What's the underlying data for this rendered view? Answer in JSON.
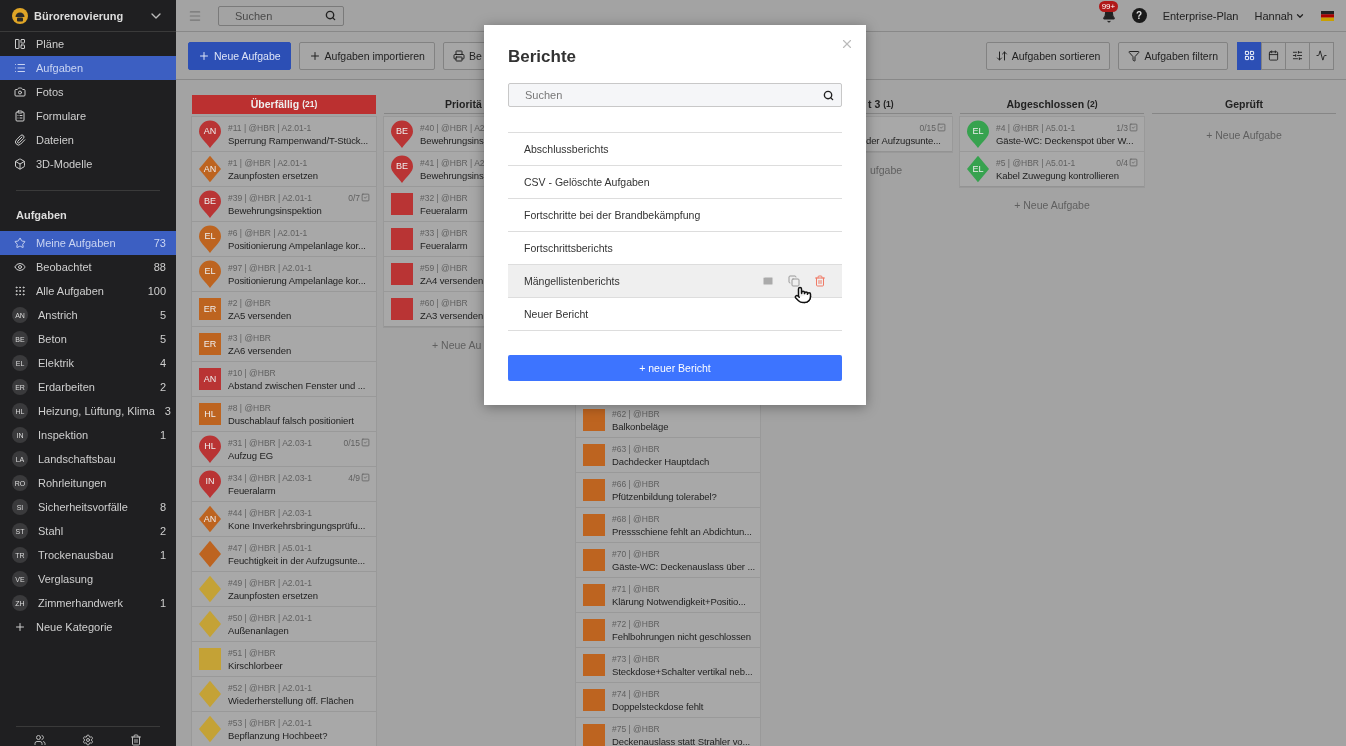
{
  "sidebar": {
    "project": "Bürorenovierung",
    "nav": [
      {
        "label": "Pläne",
        "selected": false
      },
      {
        "label": "Aufgaben",
        "selected": true
      },
      {
        "label": "Fotos",
        "selected": false
      },
      {
        "label": "Formulare",
        "selected": false
      },
      {
        "label": "Dateien",
        "selected": false
      },
      {
        "label": "3D-Modelle",
        "selected": false
      }
    ],
    "section_title": "Aufgaben",
    "items": [
      {
        "kind": "filter",
        "label": "Meine Aufgaben",
        "count": "73",
        "selected": true
      },
      {
        "kind": "filter",
        "label": "Beobachtet",
        "count": "88",
        "selected": false
      },
      {
        "kind": "filter",
        "label": "Alle Aufgaben",
        "count": "100",
        "selected": false
      },
      {
        "kind": "category",
        "initials": "AN",
        "label": "Anstrich",
        "count": "5",
        "selected": false
      },
      {
        "kind": "category",
        "initials": "BE",
        "label": "Beton",
        "count": "5",
        "selected": false
      },
      {
        "kind": "category",
        "initials": "EL",
        "label": "Elektrik",
        "count": "4",
        "selected": false
      },
      {
        "kind": "category",
        "initials": "ER",
        "label": "Erdarbeiten",
        "count": "2",
        "selected": false
      },
      {
        "kind": "category",
        "initials": "HL",
        "label": "Heizung, Lüftung, Klima",
        "count": "3",
        "selected": false
      },
      {
        "kind": "category",
        "initials": "IN",
        "label": "Inspektion",
        "count": "1",
        "selected": false
      },
      {
        "kind": "category",
        "initials": "LA",
        "label": "Landschaftsbau",
        "selected": false
      },
      {
        "kind": "category",
        "initials": "RO",
        "label": "Rohrleitungen",
        "selected": false
      },
      {
        "kind": "category",
        "initials": "SI",
        "label": "Sicherheitsvorfälle",
        "count": "8",
        "selected": false
      },
      {
        "kind": "category",
        "initials": "ST",
        "label": "Stahl",
        "count": "2",
        "selected": false
      },
      {
        "kind": "category",
        "initials": "TR",
        "label": "Trockenausbau",
        "count": "1",
        "selected": false
      },
      {
        "kind": "category",
        "initials": "VE",
        "label": "Verglasung",
        "selected": false
      },
      {
        "kind": "category",
        "initials": "ZH",
        "label": "Zimmerhandwerk",
        "count": "1",
        "selected": false
      }
    ],
    "add_category": "Neue Kategorie"
  },
  "topbar": {
    "search": {
      "placeholder": "Suchen"
    },
    "notifications": "99+",
    "help": "?",
    "plan": "Enterprise-Plan",
    "user": "Hannah"
  },
  "toolbar": {
    "left": [
      {
        "kind": "primary",
        "label": "Neue Aufgabe"
      },
      {
        "kind": "default",
        "label": "Aufgaben importieren"
      },
      {
        "kind": "default",
        "label": "Be"
      }
    ],
    "right": [
      {
        "label": "Aufgaben sortieren"
      },
      {
        "label": "Aufgaben filtern"
      }
    ],
    "views": [
      {
        "kind": "grid",
        "selected": true
      },
      {
        "kind": "calendar",
        "selected": false
      },
      {
        "kind": "gantt",
        "selected": false
      },
      {
        "kind": "chart",
        "selected": false
      }
    ]
  },
  "board": {
    "columns": [
      {
        "kind": "overdue",
        "title": "Überfällig",
        "count": "(21)",
        "cards": [
          {
            "kind": "pin",
            "color": "#b93434",
            "initials": "AN",
            "meta": "#11 | @HBR | A2.01-1",
            "title": "Sperrung Rampenwand/T-Stück..."
          },
          {
            "kind": "diamond",
            "color": "#bd6420",
            "initials": "AN",
            "meta": "#1 | @HBR | A2.01-1",
            "title": "Zaunpfosten ersetzen"
          },
          {
            "kind": "pin",
            "color": "#b93434",
            "initials": "BE",
            "meta": "#39 | @HBR | A2.01-1",
            "checklist": "0/7",
            "title": "Bewehrungsinspektion"
          },
          {
            "kind": "pin",
            "color": "#bd6420",
            "initials": "EL",
            "meta": "#6 | @HBR | A2.01-1",
            "title": "Positionierung Ampelanlage kor..."
          },
          {
            "kind": "pin",
            "color": "#bd6420",
            "initials": "EL",
            "meta": "#97 | @HBR | A2.01-1",
            "title": "Positionierung Ampelanlage kor..."
          },
          {
            "kind": "square",
            "color": "#bd6420",
            "initials": "ER",
            "meta": "#2 | @HBR",
            "title": "ZA5 versenden"
          },
          {
            "kind": "square",
            "color": "#bd6420",
            "initials": "ER",
            "meta": "#3 | @HBR",
            "title": "ZA6 versenden"
          },
          {
            "kind": "square",
            "color": "#b93434",
            "initials": "AN",
            "meta": "#10 | @HBR",
            "title": "Abstand zwischen Fenster und ..."
          },
          {
            "kind": "square",
            "color": "#bd6420",
            "initials": "HL",
            "meta": "#8 | @HBR",
            "title": "Duschablauf falsch positioniert"
          },
          {
            "kind": "pin",
            "color": "#b93434",
            "initials": "HL",
            "meta": "#31 | @HBR | A2.03-1",
            "checklist": "0/15",
            "title": "Aufzug EG"
          },
          {
            "kind": "pin",
            "color": "#b93434",
            "initials": "IN",
            "meta": "#34 | @HBR | A2.03-1",
            "checklist": "4/9",
            "title": "Feueralarm"
          },
          {
            "kind": "diamond",
            "color": "#bd6420",
            "initials": "AN",
            "meta": "#44 | @HBR | A2.03-1",
            "title": "Kone Inverkehrsbringungsprüfu..."
          },
          {
            "kind": "diamond",
            "color": "#bd6420",
            "meta": "#47 | @HBR | A5.01-1",
            "title": "Feuchtigkeit in der Aufzugsunte..."
          },
          {
            "kind": "diamond",
            "color": "#c4a236",
            "meta": "#49 | @HBR | A2.01-1",
            "title": "Zaunpfosten ersetzen"
          },
          {
            "kind": "diamond",
            "color": "#c4a236",
            "meta": "#50 | @HBR | A2.01-1",
            "title": "Außenanlagen"
          },
          {
            "kind": "square",
            "color": "#c4a236",
            "meta": "#51 | @HBR",
            "title": "Kirschlorbeer"
          },
          {
            "kind": "diamond",
            "color": "#c4a236",
            "meta": "#52 | @HBR | A2.01-1",
            "title": "Wiederherstellung öff. Flächen"
          },
          {
            "kind": "diamond",
            "color": "#c4a236",
            "meta": "#53 | @HBR | A2.01-1",
            "title": "Bepflanzung Hochbeet?"
          }
        ]
      },
      {
        "kind": "normal",
        "title": "Prioritä",
        "cards": [
          {
            "kind": "pin",
            "color": "#b93434",
            "initials": "BE",
            "meta": "#40 | @HBR | A2.",
            "title": "Bewehrungsins"
          },
          {
            "kind": "pin",
            "color": "#b93434",
            "initials": "BE",
            "meta": "#41 | @HBR | A2.",
            "title": "Bewehrungsins"
          },
          {
            "kind": "square",
            "color": "#b93434",
            "meta": "#32 | @HBR",
            "title": "Feueralarm"
          },
          {
            "kind": "square",
            "color": "#b93434",
            "meta": "#33 | @HBR",
            "title": "Feueralarm"
          },
          {
            "kind": "square",
            "color": "#b93434",
            "meta": "#59 | @HBR",
            "title": "ZA4 versenden"
          },
          {
            "kind": "square",
            "color": "#b93434",
            "meta": "#60 | @HBR",
            "title": "ZA3 versenden"
          }
        ],
        "add": "+ Neue Au"
      },
      {
        "cards": [
          {
            "kind": "square",
            "color": "#bd6420",
            "meta": "#62 | @HBR",
            "title": "Balkonbeläge"
          },
          {
            "kind": "square",
            "color": "#bd6420",
            "meta": "#63 | @HBR",
            "title": "Dachdecker Hauptdach"
          },
          {
            "kind": "square",
            "color": "#bd6420",
            "meta": "#66 | @HBR",
            "title": "Pfützenbildung tolerabel?"
          },
          {
            "kind": "square",
            "color": "#bd6420",
            "meta": "#68 | @HBR",
            "title": "Pressschiene fehlt an Abdichtun..."
          },
          {
            "kind": "square",
            "color": "#bd6420",
            "meta": "#70 | @HBR",
            "title": "Gäste-WC: Deckenauslass über ..."
          },
          {
            "kind": "square",
            "color": "#bd6420",
            "meta": "#71 | @HBR",
            "title": "Klärung Notwendigkeit+Positio..."
          },
          {
            "kind": "square",
            "color": "#bd6420",
            "meta": "#72 | @HBR",
            "title": "Fehlbohrungen nicht geschlossen"
          },
          {
            "kind": "square",
            "color": "#bd6420",
            "meta": "#73 | @HBR",
            "title": "Steckdose+Schalter vertikal neb..."
          },
          {
            "kind": "square",
            "color": "#bd6420",
            "meta": "#74 | @HBR",
            "title": "Doppelsteckdose fehlt"
          },
          {
            "kind": "square",
            "color": "#bd6420",
            "meta": "#75 | @HBR",
            "title": "Deckenauslass statt Strahler vo..."
          }
        ]
      },
      {
        "kind": "normal",
        "title": "t 3",
        "count": "(1)",
        "cards": [
          {
            "checklist": "0/15",
            "title": "der Aufzugsunte..."
          }
        ],
        "add": "ufgabe"
      },
      {
        "kind": "normal",
        "title": "Abgeschlossen",
        "count": "(2)",
        "cards": [
          {
            "kind": "pin",
            "color": "#37a24f",
            "initials": "EL",
            "meta": "#4 | @HBR | A5.01-1",
            "checklist": "1/3",
            "title": "Gäste-WC: Deckenspot über W..."
          },
          {
            "kind": "diamond",
            "color": "#37a24f",
            "initials": "EL",
            "meta": "#5 | @HBR | A5.01-1",
            "checklist": "0/4",
            "title": "Kabel Zuwegung kontrollieren"
          }
        ],
        "add": "+ Neue Aufgabe"
      },
      {
        "kind": "normal",
        "title": "Geprüft",
        "add": "+ Neue Aufgabe"
      }
    ]
  },
  "dialog": {
    "title": "Berichte",
    "search": {
      "placeholder": "Suchen"
    },
    "reports": [
      {
        "label": "Abschlussberichts",
        "hovered": false
      },
      {
        "label": "CSV - Gelöschte Aufgaben",
        "hovered": false
      },
      {
        "label": "Fortschritte bei der Brandbekämpfung",
        "hovered": false
      },
      {
        "label": "Fortschrittsberichts",
        "hovered": false
      },
      {
        "label": "Mängellistenberichts",
        "hovered": true
      },
      {
        "label": "Neuer Bericht",
        "hovered": false
      }
    ],
    "button": "+ neuer Bericht"
  }
}
